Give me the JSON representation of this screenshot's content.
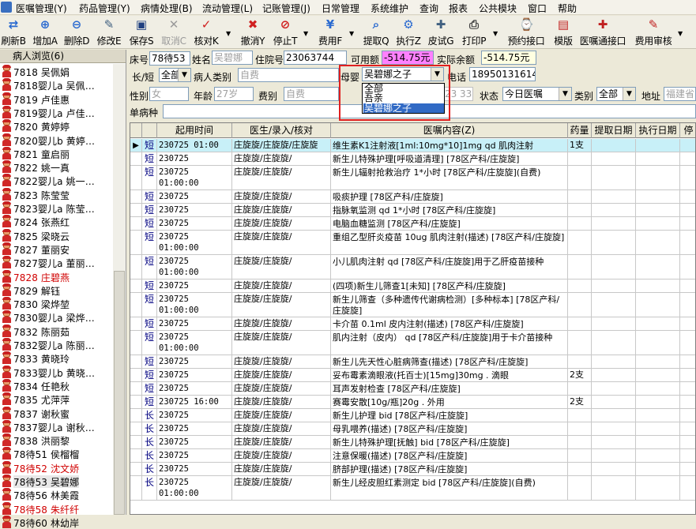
{
  "menu": [
    "医嘱管理(Y)",
    "药品管理(Y)",
    "病情处理(B)",
    "流动管理(L)",
    "记账管理(J)",
    "日常管理",
    "系统维护",
    "查询",
    "报表",
    "公共模块",
    "窗口",
    "帮助"
  ],
  "toolbar": [
    {
      "label": "刷新B",
      "icon": "refresh-icon",
      "disabled": false
    },
    {
      "label": "增加A",
      "icon": "add-icon",
      "disabled": false
    },
    {
      "label": "删除D",
      "icon": "delete-icon",
      "disabled": false
    },
    {
      "label": "修改E",
      "icon": "edit-icon",
      "disabled": false
    },
    {
      "label": "保存S",
      "icon": "save-icon",
      "disabled": false
    },
    {
      "label": "取消C",
      "icon": "cancel-icon",
      "disabled": true
    },
    {
      "label": "核对K",
      "icon": "check-icon",
      "disabled": false
    },
    {
      "label": "撤消Y",
      "icon": "undo-icon",
      "disabled": false
    },
    {
      "label": "停止T",
      "icon": "stop-icon",
      "disabled": false
    },
    {
      "label": "费用F",
      "icon": "fee-icon",
      "disabled": false
    },
    {
      "label": "提取Q",
      "icon": "extract-icon",
      "disabled": false
    },
    {
      "label": "执行Z",
      "icon": "execute-icon",
      "disabled": false
    },
    {
      "label": "皮试G",
      "icon": "skintest-icon",
      "disabled": false
    },
    {
      "label": "打印P",
      "icon": "print-icon",
      "disabled": false
    },
    {
      "label": "预约接口",
      "icon": "appointment-icon",
      "disabled": false
    },
    {
      "label": "模版",
      "icon": "template-icon",
      "disabled": false
    },
    {
      "label": "医嘱通接口",
      "icon": "order-interface-icon",
      "disabled": false
    },
    {
      "label": "费用审核",
      "icon": "fee-audit-icon",
      "disabled": false
    }
  ],
  "sidebar": {
    "title": "病人浏览(6)",
    "patients": [
      {
        "text": "7818  吴佩娟",
        "red": false
      },
      {
        "text": "7818婴儿a 吴佩…",
        "red": false
      },
      {
        "text": "7819  卢佳惠",
        "red": false
      },
      {
        "text": "7819婴儿a 卢佳…",
        "red": false
      },
      {
        "text": "7820  黄婷婷",
        "red": false
      },
      {
        "text": "7820婴儿b 黄婷…",
        "red": false
      },
      {
        "text": "7821  童启丽",
        "red": false
      },
      {
        "text": "7822  姚一真",
        "red": false
      },
      {
        "text": "7822婴儿a 姚一…",
        "red": false
      },
      {
        "text": "7823  陈莹莹",
        "red": false
      },
      {
        "text": "7823婴儿a 陈莹…",
        "red": false
      },
      {
        "text": "7824  张燕红",
        "red": false
      },
      {
        "text": "7825  梁晓云",
        "red": false
      },
      {
        "text": "7827  董丽安",
        "red": false
      },
      {
        "text": "7827婴儿a 董丽…",
        "red": false
      },
      {
        "text": "7828  庄碧燕",
        "red": true
      },
      {
        "text": "7829  解钰",
        "red": false
      },
      {
        "text": "7830  梁烨堃",
        "red": false
      },
      {
        "text": "7830婴儿a 梁烨…",
        "red": false
      },
      {
        "text": "7832  陈丽茹",
        "red": false
      },
      {
        "text": "7832婴儿a 陈丽…",
        "red": false
      },
      {
        "text": "7833  黄晓玲",
        "red": false
      },
      {
        "text": "7833婴儿b 黄晓…",
        "red": false
      },
      {
        "text": "7834  任艳秋",
        "red": false
      },
      {
        "text": "7835  尤萍萍",
        "red": false
      },
      {
        "text": "7837  谢秋蜜",
        "red": false
      },
      {
        "text": "7837婴儿a 谢秋…",
        "red": false
      },
      {
        "text": "7838  洪丽黎",
        "red": false
      },
      {
        "text": "78待51 侯榴榴",
        "red": false
      },
      {
        "text": "78待52 沈文娇",
        "red": true
      },
      {
        "text": "78待53 吴碧娜",
        "red": false
      },
      {
        "text": "78待56 林美霞",
        "red": false
      },
      {
        "text": "78待58 朱纤纤",
        "red": true
      },
      {
        "text": "78待60 林幼岸",
        "red": false
      }
    ]
  },
  "form": {
    "bed_label": "床号",
    "bed_value": "78待53",
    "name_label": "姓名",
    "name_value": "吴碧娜",
    "inpatient_no_label": "住院号",
    "inpatient_no_value": "23063744",
    "available_label": "可用额",
    "available_value": "-514.75元",
    "balance_label": "实际余额",
    "balance_value": "-514.75元",
    "long_short_label": "长/短",
    "long_short_value": "全部",
    "patient_type_label": "病人类别",
    "patient_type_value": "自费",
    "mother_baby_label": "母婴",
    "mother_baby_value": "吴碧娜之子",
    "phone_label": "电话",
    "phone_value": "18950131614",
    "gender_label": "性别",
    "gender_value": "女",
    "age_label": "年龄",
    "age_value": "27岁",
    "fee_type_label": "费别",
    "fee_type_value": "自费",
    "date_partial": "23",
    "time_partial": "33",
    "status_label": "状态",
    "status_value": "今日医嘱",
    "category_label": "类别",
    "category_value": "全部",
    "address_label": "地址",
    "address_value": "福建省",
    "disease_label": "单病种",
    "disease_value": ""
  },
  "dropdown": {
    "options": [
      "全部",
      "吾亲",
      "吴碧娜之子"
    ],
    "selected": "吴碧娜之子"
  },
  "grid": {
    "headers": [
      "",
      "",
      "起用时间",
      "医生/录入/核对",
      "医嘱内容(Z)",
      "药量",
      "提取日期",
      "执行日期",
      "停"
    ],
    "rows": [
      {
        "type": "短",
        "time": "230725 01:00",
        "doctor": "庄旋旋/庄旋旋/庄旋旋",
        "content": "维生素K1注射液[1ml:10mg*10]1mg qd 肌肉注射",
        "qty": "1支"
      },
      {
        "type": "短",
        "time": "230725 01:00:00",
        "doctor": "庄旋旋/庄旋旋/",
        "content": "新生儿特殊护理[呼吸道清理]   [78区产科/庄旋旋]",
        "qty": ""
      },
      {
        "type": "短",
        "time": "230725 01:00:00",
        "doctor": "庄旋旋/庄旋旋/",
        "content": "新生儿辐射抢救治疗  1*小时  [78区产科/庄旋旋](自费)",
        "qty": ""
      },
      {
        "type": "短",
        "time": "230725 01:00:00",
        "doctor": "庄旋旋/庄旋旋/",
        "content": "吸痰护理   [78区产科/庄旋旋]",
        "qty": ""
      },
      {
        "type": "短",
        "time": "230725 01:00:00",
        "doctor": "庄旋旋/庄旋旋/",
        "content": "指脉氧监测 qd 1*小时  [78区产科/庄旋旋]",
        "qty": ""
      },
      {
        "type": "短",
        "time": "230725 01:00:00",
        "doctor": "庄旋旋/庄旋旋/",
        "content": "电脑血糖监测   [78区产科/庄旋旋]",
        "qty": ""
      },
      {
        "type": "短",
        "time": "230725 01:00:00",
        "doctor": "庄旋旋/庄旋旋/",
        "content": "重组乙型肝炎疫苗 10ug 肌肉注射(描述)   [78区产科/庄旋旋]",
        "qty": ""
      },
      {
        "type": "短",
        "time": "230725 01:00:00",
        "doctor": "庄旋旋/庄旋旋/",
        "content": "小儿肌肉注射 qd  [78区产科/庄旋旋]用于乙肝疫苗接种",
        "qty": ""
      },
      {
        "type": "短",
        "time": "230725 01:00:00",
        "doctor": "庄旋旋/庄旋旋/",
        "content": "(四项)新生儿筛查1[未知]   [78区产科/庄旋旋]",
        "qty": ""
      },
      {
        "type": "短",
        "time": "230725 01:00:00",
        "doctor": "庄旋旋/庄旋旋/",
        "content": "新生儿筛查（多种遗传代谢病检测）[多种标本]   [78区产科/庄旋旋]",
        "qty": ""
      },
      {
        "type": "短",
        "time": "230725 01:00:00",
        "doctor": "庄旋旋/庄旋旋/",
        "content": "卡介苗 0.1ml 皮内注射(描述)   [78区产科/庄旋旋]",
        "qty": ""
      },
      {
        "type": "短",
        "time": "230725 01:00:00",
        "doctor": "庄旋旋/庄旋旋/",
        "content": "肌内注射（皮内） qd  [78区产科/庄旋旋]用于卡介苗接种",
        "qty": ""
      },
      {
        "type": "短",
        "time": "230725 01:00:00",
        "doctor": "庄旋旋/庄旋旋/",
        "content": "新生儿先天性心脏病筛查(描述)   [78区产科/庄旋旋]",
        "qty": ""
      },
      {
        "type": "短",
        "time": "230725 01:00:00",
        "doctor": "庄旋旋/庄旋旋/",
        "content": "妥布霉素滴眼液(托百士)[15mg]30mg . 滴眼",
        "qty": "2支"
      },
      {
        "type": "短",
        "time": "230725 01:00:00",
        "doctor": "庄旋旋/庄旋旋/",
        "content": "耳声发射检查   [78区产科/庄旋旋]",
        "qty": ""
      },
      {
        "type": "短",
        "time": "230725 16:00",
        "doctor": "庄旋旋/庄旋旋/",
        "content": "赛霉安散[10g/瓶]20g . 外用",
        "qty": "2支"
      },
      {
        "type": "长",
        "time": "230725 01:00:00",
        "doctor": "庄旋旋/庄旋旋/",
        "content": "新生儿护理 bid  [78区产科/庄旋旋]",
        "qty": ""
      },
      {
        "type": "长",
        "time": "230725 01:00:00",
        "doctor": "庄旋旋/庄旋旋/",
        "content": "母乳喂养(描述)   [78区产科/庄旋旋]",
        "qty": ""
      },
      {
        "type": "长",
        "time": "230725 01:00:00",
        "doctor": "庄旋旋/庄旋旋/",
        "content": "新生儿特殊护理[抚触] bid  [78区产科/庄旋旋]",
        "qty": ""
      },
      {
        "type": "长",
        "time": "230725 01:00:00",
        "doctor": "庄旋旋/庄旋旋/",
        "content": "注意保暖(描述)   [78区产科/庄旋旋]",
        "qty": ""
      },
      {
        "type": "长",
        "time": "230725 01:00:00",
        "doctor": "庄旋旋/庄旋旋/",
        "content": "脐部护理(描述)   [78区产科/庄旋旋]",
        "qty": ""
      },
      {
        "type": "长",
        "time": "230725 01:00:00",
        "doctor": "庄旋旋/庄旋旋/",
        "content": "新生儿经皮胆红素测定 bid  [78区产科/庄旋旋](自费)",
        "qty": ""
      }
    ]
  },
  "colors": {
    "red_name": "#d00000",
    "highlight_border": "#e02020",
    "selection": "#316ac5",
    "current_row": "#c8f0f8",
    "amount_bg": "#ff80ff"
  }
}
